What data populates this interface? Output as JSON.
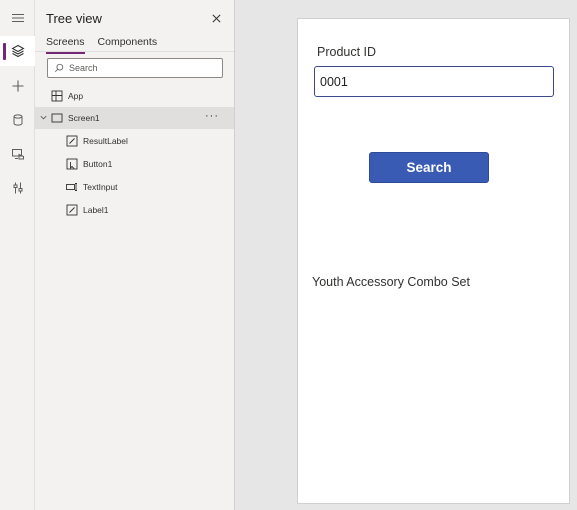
{
  "rail": {
    "items": [
      {
        "name": "hamburger-menu"
      },
      {
        "name": "tree-view",
        "active": true
      },
      {
        "name": "insert"
      },
      {
        "name": "data"
      },
      {
        "name": "media"
      },
      {
        "name": "advanced-tools"
      }
    ]
  },
  "tree_view": {
    "title": "Tree view",
    "tabs": [
      "Screens",
      "Components"
    ],
    "active_tab": "Screens",
    "search_placeholder": "Search",
    "items": [
      {
        "label": "App",
        "icon": "app-icon"
      },
      {
        "label": "Screen1",
        "icon": "screen-icon",
        "selected": true,
        "expanded": true
      },
      {
        "label": "ResultLabel",
        "icon": "label-edit-icon"
      },
      {
        "label": "Button1",
        "icon": "button-icon"
      },
      {
        "label": "TextInput",
        "icon": "text-input-icon"
      },
      {
        "label": "Label1",
        "icon": "label-edit-icon"
      }
    ],
    "more_label": "···"
  },
  "canvas": {
    "product_label": "Product ID",
    "product_input_value": "0001",
    "search_button_label": "Search",
    "result_label": "Youth Accessory Combo Set"
  },
  "colors": {
    "accent": "#742774",
    "button": "#3a5bb4",
    "input_border": "#3c4a8c"
  }
}
